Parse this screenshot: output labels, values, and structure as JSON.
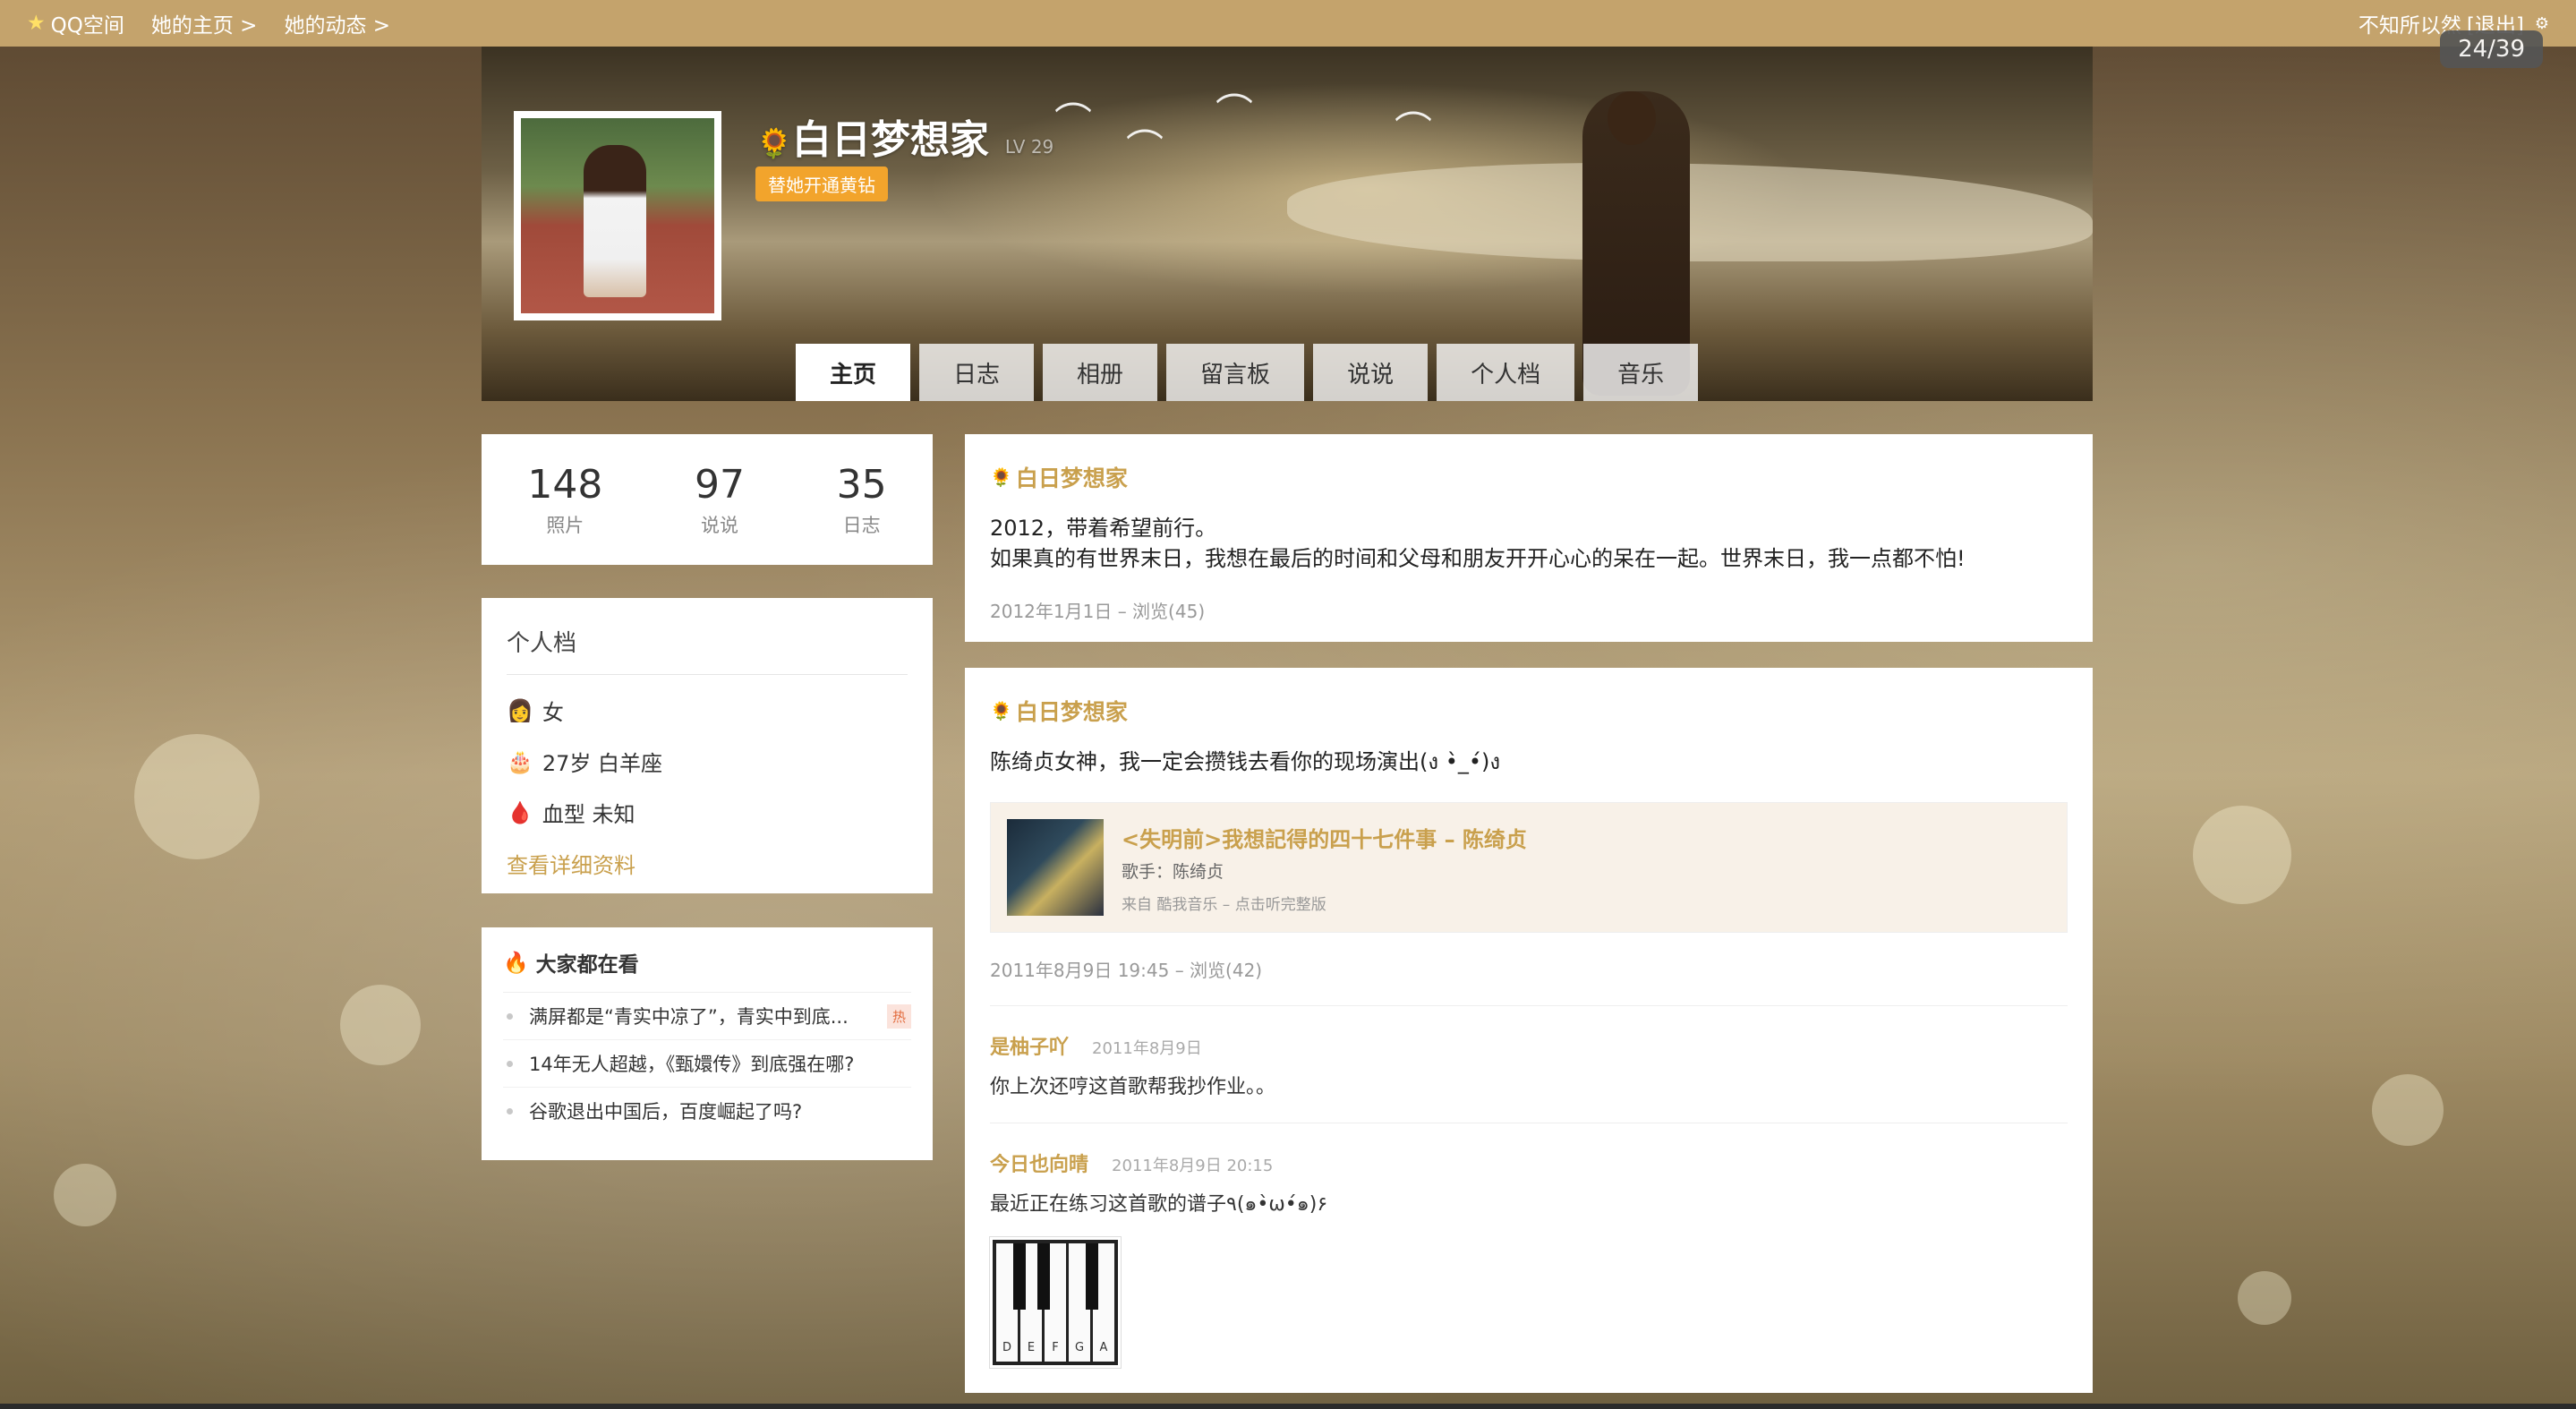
{
  "topbar": {
    "qzone": "QQ空间",
    "her_home": "她的主页 >",
    "her_feed": "她的动态 >",
    "user": "不知所以然",
    "logout": "[退出]"
  },
  "counter": "24/39",
  "profile_header": {
    "name": "白日梦想家",
    "level": "LV 29",
    "vip_button": "替她开通黄钻"
  },
  "tabs": [
    "主页",
    "日志",
    "相册",
    "留言板",
    "说说",
    "个人档",
    "音乐"
  ],
  "stats": [
    {
      "num": "148",
      "label": "照片"
    },
    {
      "num": "97",
      "label": "说说"
    },
    {
      "num": "35",
      "label": "日志"
    }
  ],
  "profile_card": {
    "title": "个人档",
    "gender": "女",
    "age": "27岁 白羊座",
    "blood": "血型 未知",
    "detail_link": "查看详细资料"
  },
  "trending": {
    "title": "大家都在看",
    "hot": "热",
    "items": [
      "满屏都是“青实中凉了”，青实中到底...",
      "14年无人超越，《甄嬛传》到底强在哪?",
      "谷歌退出中国后，百度崛起了吗?"
    ]
  },
  "post1": {
    "author": "白日梦想家",
    "line1": "2012，带着希望前行。",
    "line2": "如果真的有世界末日，我想在最后的时间和父母和朋友开开心心的呆在一起。世界末日，我一点都不怕!",
    "meta": "2012年1月1日 – 浏览(45)"
  },
  "post2": {
    "author": "白日梦想家",
    "text": "陈绮贞女神，我一定会攒钱去看你的现场演出(ง •̀_•́)ง",
    "music_title": "<失明前>我想記得的四十七件事 – 陈绮贞",
    "music_singer": "歌手：陈绮贞",
    "music_source": "来自 酷我音乐 – 点击听完整版",
    "meta": "2011年8月9日 19:45 – 浏览(42)",
    "comments": [
      {
        "name": "是柚子吖",
        "time": "2011年8月9日",
        "text": "你上次还哼这首歌帮我抄作业。。"
      },
      {
        "name": "今日也向晴",
        "time": "2011年8月9日 20:15",
        "text": "最近正在练习这首歌的谱子٩(๑•̀ω•́๑)۶"
      }
    ],
    "piano_keys": [
      "D",
      "E",
      "F",
      "G",
      "A"
    ]
  },
  "colors": {
    "accent": "#c9a04d",
    "topbar": "#c4a36c",
    "vip": "#f2a42c"
  }
}
